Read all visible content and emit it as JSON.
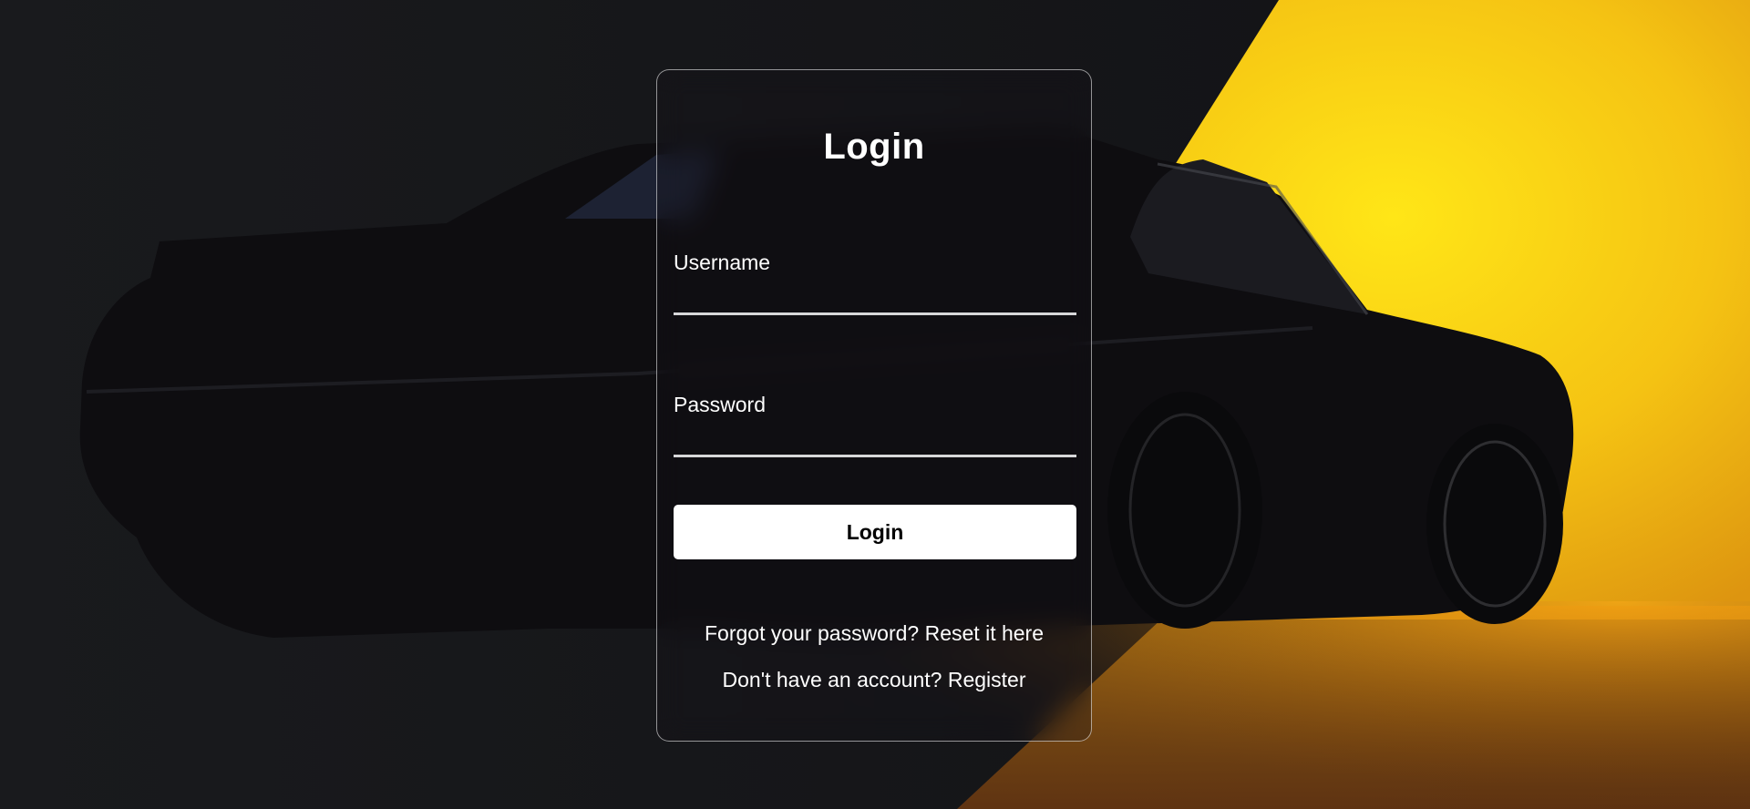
{
  "background": {
    "accent": "#f7d21a",
    "shadow": "#16171a"
  },
  "login": {
    "title": "Login",
    "username_label": "Username",
    "username_value": "",
    "password_label": "Password",
    "password_value": "",
    "submit_label": "Login",
    "forgot_text": "Forgot your password?",
    "forgot_link": "Reset it here",
    "register_text": "Don't have an account?",
    "register_link": "Register"
  }
}
